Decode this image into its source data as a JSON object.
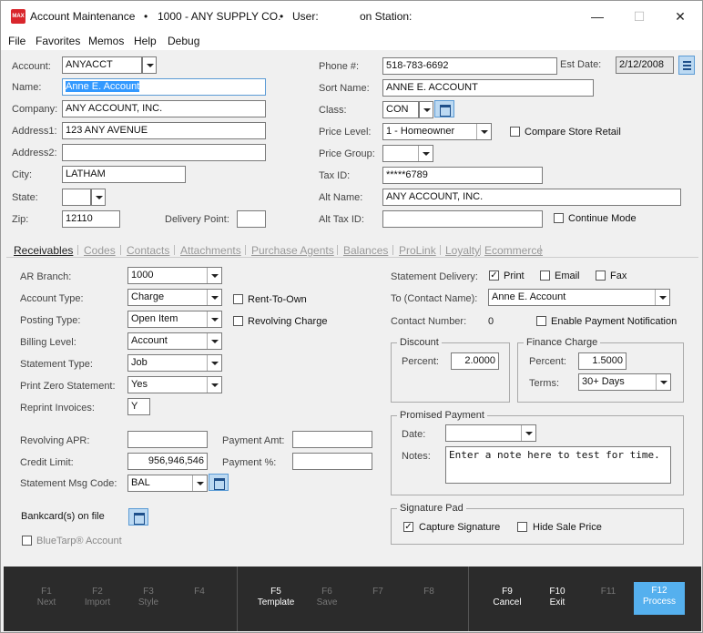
{
  "title": {
    "app": "Account Maintenance",
    "bullet": "•",
    "store": "1000 - ANY SUPPLY CO.",
    "user": "User:",
    "station": "on Station:",
    "logo": "MAX"
  },
  "menu": [
    "File",
    "Favorites",
    "Memos",
    "Help",
    "Debug"
  ],
  "header": {
    "account_label": "Account:",
    "account_value": "ANYACCT",
    "name_label": "Name:",
    "name_value": "Anne E. Account",
    "company_label": "Company:",
    "company_value": "ANY ACCOUNT, INC.",
    "address1_label": "Address1:",
    "address1_value": "123 ANY AVENUE",
    "address2_label": "Address2:",
    "address2_value": "",
    "city_label": "City:",
    "city_value": "LATHAM",
    "state_label": "State:",
    "state_value": "",
    "zip_label": "Zip:",
    "zip_value": "12110",
    "delivery_label": "Delivery Point:",
    "delivery_value": "",
    "phone_label": "Phone #:",
    "phone_value": "518-783-6692",
    "estdate_label": "Est Date:",
    "estdate_value": "2/12/2008",
    "sortname_label": "Sort Name:",
    "sortname_value": "ANNE E. ACCOUNT",
    "class_label": "Class:",
    "class_value": "CON",
    "pricelevel_label": "Price Level:",
    "pricelevel_value": "1 - Homeowner",
    "compare_label": "Compare Store Retail",
    "pricegroup_label": "Price Group:",
    "pricegroup_value": "",
    "taxid_label": "Tax ID:",
    "taxid_value": "*****6789",
    "altname_label": "Alt  Name:",
    "altname_value": "ANY ACCOUNT, INC.",
    "alttax_label": "Alt Tax ID:",
    "alttax_value": "",
    "continue_label": "Continue Mode"
  },
  "tabs": [
    "Receivables",
    "Codes",
    "Contacts",
    "Attachments",
    "Purchase Agents",
    "Balances",
    "ProLink",
    "Loyalty",
    "Ecommerce"
  ],
  "receivables": {
    "arbranch_label": "AR Branch:",
    "arbranch_value": "1000",
    "accttype_label": "Account Type:",
    "accttype_value": "Charge",
    "rto_label": "Rent-To-Own",
    "posting_label": "Posting Type:",
    "posting_value": "Open Item",
    "revcharge_label": "Revolving Charge",
    "billing_label": "Billing Level:",
    "billing_value": "Account",
    "stmttype_label": "Statement Type:",
    "stmttype_value": "Job",
    "printzero_label": "Print Zero Statement:",
    "printzero_value": "Yes",
    "reprint_label": "Reprint Invoices:",
    "reprint_value": "Y",
    "apr_label": "Revolving APR:",
    "apr_value": "",
    "payamt_label": "Payment Amt:",
    "payamt_value": "",
    "credit_label": "Credit Limit:",
    "credit_value": "956,946,546",
    "paypct_label": "Payment %:",
    "paypct_value": "",
    "msgcode_label": "Statement Msg Code:",
    "msgcode_value": "BAL",
    "bankcard_label": "Bankcard(s) on file",
    "bluetarp_label": "BlueTarp® Account",
    "stmtdelivery_label": "Statement Delivery:",
    "print_label": "Print",
    "email_label": "Email",
    "fax_label": "Fax",
    "tocontact_label": "To (Contact Name):",
    "tocontact_value": "Anne E. Account",
    "contactnum_label": "Contact Number:",
    "contactnum_value": "0",
    "enablepay_label": "Enable Payment Notification",
    "discount_title": "Discount",
    "discount_pct_label": "Percent:",
    "discount_pct_value": "2.0000",
    "finance_title": "Finance Charge",
    "finance_pct_label": "Percent:",
    "finance_pct_value": "1.5000",
    "terms_label": "Terms:",
    "terms_value": "30+ Days",
    "promised_title": "Promised Payment",
    "date_label": "Date:",
    "date_value": "",
    "notes_label": "Notes:",
    "notes_value": "Enter a note here to test for time.",
    "sigpad_title": "Signature Pad",
    "capture_label": "Capture Signature",
    "hideprice_label": "Hide Sale Price"
  },
  "fkeys": [
    {
      "key": "F1",
      "label": "Next"
    },
    {
      "key": "F2",
      "label": "Import"
    },
    {
      "key": "F3",
      "label": "Style"
    },
    {
      "key": "F4",
      "label": ""
    },
    {
      "key": "F5",
      "label": "Template"
    },
    {
      "key": "F6",
      "label": "Save"
    },
    {
      "key": "F7",
      "label": ""
    },
    {
      "key": "F8",
      "label": ""
    },
    {
      "key": "F9",
      "label": "Cancel"
    },
    {
      "key": "F10",
      "label": "Exit"
    },
    {
      "key": "F11",
      "label": ""
    },
    {
      "key": "F12",
      "label": "Process"
    }
  ],
  "window_controls": {
    "minimize": "—",
    "maximize": "☐",
    "close": "✕"
  }
}
